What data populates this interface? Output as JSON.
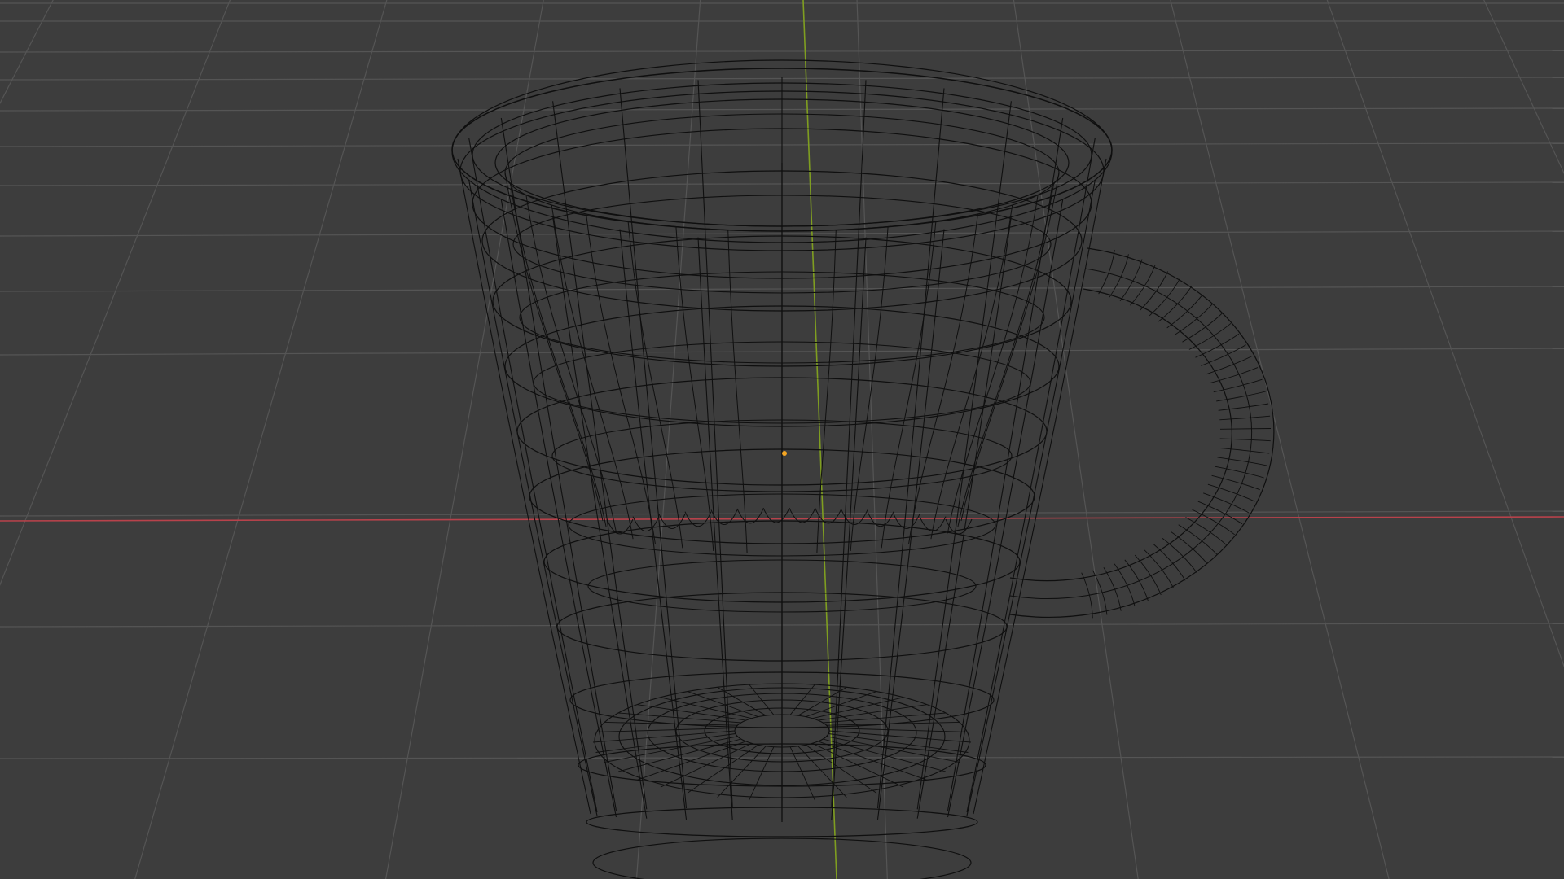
{
  "app": {
    "area": "3d-viewport",
    "shading_mode": "wireframe"
  },
  "scene": {
    "object": "mug",
    "object_parts": [
      "mug-body",
      "mug-inner-wall",
      "mug-rim",
      "mug-handle"
    ],
    "origin_selected": true
  },
  "colors": {
    "background": "#3d3d3d",
    "grid": "#555555",
    "x_axis": "#b8424b",
    "y_axis": "#7f9e20",
    "wire": "#0f0f0f",
    "origin": "#f5a623"
  },
  "icons": [
    "origin-point-icon"
  ]
}
